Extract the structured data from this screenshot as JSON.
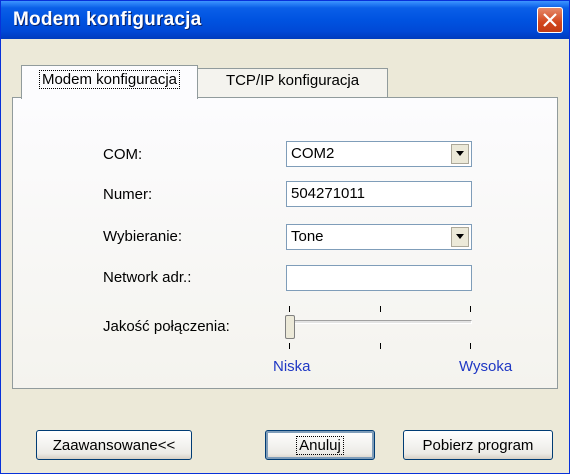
{
  "window": {
    "title": "Modem konfiguracja"
  },
  "tabs": [
    {
      "label": "Modem konfiguracja",
      "active": true
    },
    {
      "label": "TCP/IP konfiguracja",
      "active": false
    }
  ],
  "form": {
    "com": {
      "label": "COM:",
      "value": "COM2"
    },
    "numer": {
      "label": "Numer:",
      "value": "504271011"
    },
    "wybieranie": {
      "label": "Wybieranie:",
      "value": "Tone"
    },
    "network": {
      "label": "Network adr.:",
      "value": ""
    },
    "jakosc": {
      "label": "Jakość połączenia:",
      "level": 0,
      "min_label": "Niska",
      "max_label": "Wysoka"
    }
  },
  "buttons": {
    "advanced": "Zaawansowane<<",
    "cancel": "Anuluj",
    "download": "Pobierz program"
  },
  "colors": {
    "titlebar": "#0053e0",
    "slider_labels": "#1f38c4",
    "close": "#d2461d"
  }
}
